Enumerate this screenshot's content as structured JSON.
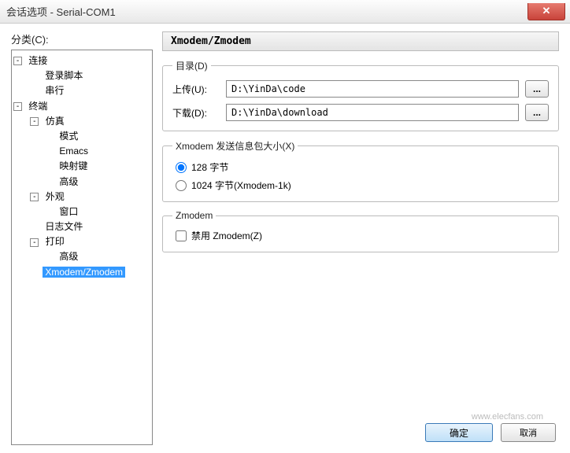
{
  "window": {
    "title": "会话选项 - Serial-COM1",
    "close_symbol": "✕"
  },
  "category_label": "分类(C):",
  "tree": {
    "n0": "连接",
    "n0_0": "登录脚本",
    "n0_1": "串行",
    "n1": "终端",
    "n1_0": "仿真",
    "n1_0_0": "模式",
    "n1_0_1": "Emacs",
    "n1_0_2": "映射键",
    "n1_0_3": "高级",
    "n1_1": "外观",
    "n1_1_0": "窗口",
    "n1_2": "日志文件",
    "n1_3": "打印",
    "n1_3_0": "高级",
    "n1_4": "Xmodem/Zmodem"
  },
  "panel_title": "Xmodem/Zmodem",
  "dir": {
    "legend": "目录(D)",
    "upload_label": "上传(U):",
    "upload_value": "D:\\YinDa\\code",
    "download_label": "下载(D):",
    "download_value": "D:\\YinDa\\download",
    "browse": "..."
  },
  "xmodem": {
    "legend": "Xmodem 发送信息包大小(X)",
    "opt128": "128 字节",
    "opt1024": "1024 字节(Xmodem-1k)"
  },
  "zmodem": {
    "legend": "Zmodem",
    "disable_label": "禁用 Zmodem(Z)"
  },
  "buttons": {
    "ok": "确定",
    "extra": "取消"
  },
  "watermark": "www.elecfans.com"
}
